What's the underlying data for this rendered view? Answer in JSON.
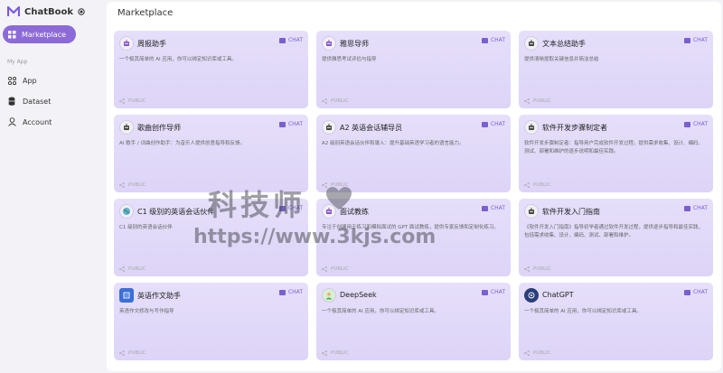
{
  "app": {
    "name": "ChatBook"
  },
  "sidebar": {
    "active_item": "Marketplace",
    "section_label": "My App",
    "items": [
      {
        "label": "App",
        "icon": "app-grid-icon"
      },
      {
        "label": "Dataset",
        "icon": "database-icon"
      },
      {
        "label": "Account",
        "icon": "user-icon"
      }
    ]
  },
  "main": {
    "title": "Marketplace",
    "chat_label": "CHAT",
    "public_label": "PUBLIC",
    "cards": [
      {
        "title": "周报助手",
        "desc": "一个极其简单的 AI 应用，你可以绑定知识库或工具。",
        "icon": "robot-icon"
      },
      {
        "title": "雅思导师",
        "desc": "提供雅思考试评估与指导",
        "icon": "robot-icon"
      },
      {
        "title": "文本总结助手",
        "desc": "提供清晰提取关键信息并简洁总结",
        "icon": "robot-icon"
      },
      {
        "title": "歌曲创作导师",
        "desc": "AI 歌手 / 词曲创作助手：为音乐人提供创意指导和反馈。",
        "icon": "robot-icon"
      },
      {
        "title": "A2 英语会话辅导员",
        "desc": "A2 级别英语会话伙伴和導入：提升基础英语学习者的语言能力。",
        "icon": "robot-icon"
      },
      {
        "title": "软件开发步骤制定者",
        "desc": "软件开发步骤制定者：指导用户完成软件开发过程，提供需求收集、设计、编码、测试、部署和维护的逐步说明和最佳实践。",
        "icon": "robot-icon"
      },
      {
        "title": "C1 级别的英语会话伙伴",
        "desc": "C1 级别的英语会话伙伴",
        "icon": "globe-icon"
      },
      {
        "title": "面试教练",
        "desc": "专注于创建用于练习和模拟面试的 GPT 面试教练，提供专家反馈和定制化练习。",
        "icon": "robot-icon"
      },
      {
        "title": "软件开发入门指南",
        "desc": "《软件开发入门指南》指导初学者通过软件开发过程，提供逐步指导和最佳实践，包括需求收集、设计、编码、测试、部署和维护。",
        "icon": "robot-icon"
      },
      {
        "title": "英语作文助手",
        "desc": "英语作文修改与写作指导",
        "icon": "book-icon"
      },
      {
        "title": "DeepSeek",
        "desc": "一个极其简单的 AI 应用，你可以绑定知识库或工具。",
        "icon": "avatar-icon"
      },
      {
        "title": "ChatGPT",
        "desc": "一个极其简单的 AI 应用，你可以绑定知识库或工具。",
        "icon": "openai-icon"
      }
    ]
  },
  "watermark": {
    "line1": "科技师",
    "line2": "https://www.3kjs.com"
  },
  "colors": {
    "accent": "#8c6ad8",
    "card_bg": "#e2dafa",
    "chat": "#7a5fcf"
  }
}
